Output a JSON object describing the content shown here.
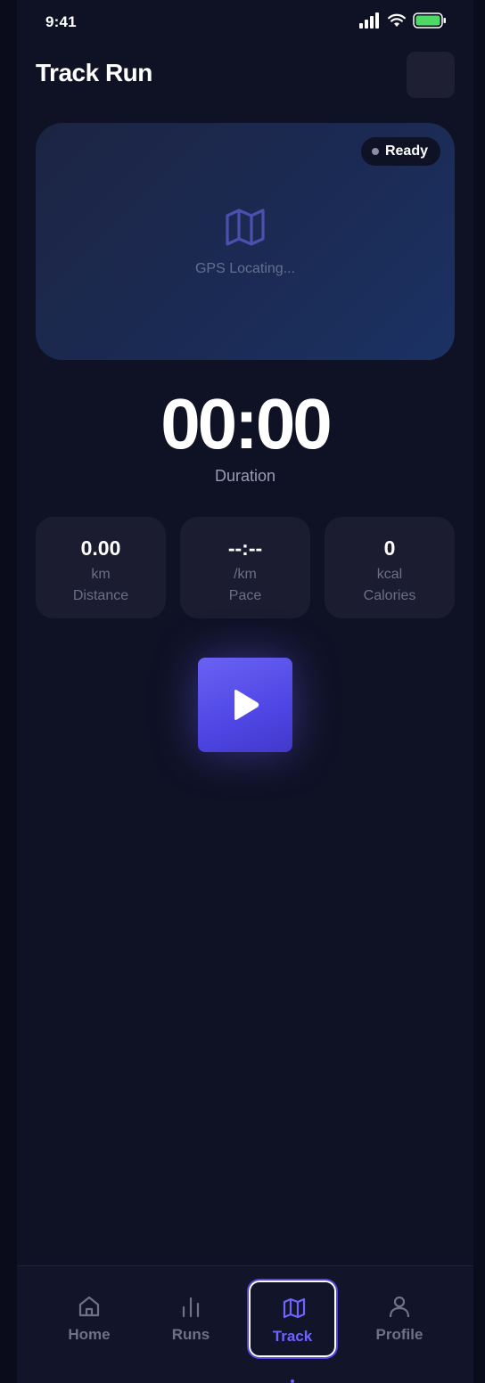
{
  "status_bar": {
    "time": "9:41"
  },
  "header": {
    "title": "Track Run"
  },
  "map": {
    "badge": "Ready",
    "message": "GPS Locating..."
  },
  "timer": {
    "value": "00:00",
    "label": "Duration"
  },
  "stats": [
    {
      "value": "0.00",
      "unit": "km",
      "label": "Distance"
    },
    {
      "value": "--:--",
      "unit": "/km",
      "label": "Pace"
    },
    {
      "value": "0",
      "unit": "kcal",
      "label": "Calories"
    }
  ],
  "tabs": [
    {
      "label": "Home",
      "icon": "home-icon"
    },
    {
      "label": "Runs",
      "icon": "chart-icon"
    },
    {
      "label": "Track",
      "icon": "map-icon",
      "active": true
    },
    {
      "label": "Profile",
      "icon": "user-icon"
    }
  ],
  "colors": {
    "accent": "#4f46e5",
    "background": "#0f1124",
    "card": "#1b1c2f"
  }
}
